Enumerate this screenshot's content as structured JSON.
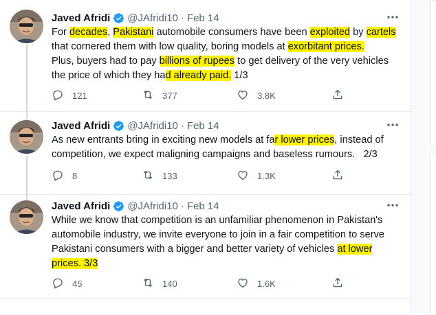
{
  "tweets": [
    {
      "name": "Javed Afridi",
      "handle": "@JAfridi10",
      "separator": "·",
      "date": "Feb 14",
      "body_segments": [
        {
          "text": "For ",
          "hl": false
        },
        {
          "text": "decades",
          "hl": true
        },
        {
          "text": ", ",
          "hl": false
        },
        {
          "text": "Pakistani",
          "hl": true
        },
        {
          "text": " automobile consumers have been ",
          "hl": false
        },
        {
          "text": "exploited",
          "hl": true
        },
        {
          "text": " by ",
          "hl": false
        },
        {
          "text": "cartels",
          "hl": true
        },
        {
          "text": "\nthat cornered them with low quality, boring models at ",
          "hl": false
        },
        {
          "text": "exorbitant prices.",
          "hl": true
        },
        {
          "text": "\nPlus, buyers had to pay ",
          "hl": false
        },
        {
          "text": "billions of rupees",
          "hl": true
        },
        {
          "text": " to get delivery of the very vehicles\nthe price of which they ha",
          "hl": false
        },
        {
          "text": "d already paid.",
          "hl": true
        },
        {
          "text": " 1/3",
          "hl": false
        }
      ],
      "replies": "121",
      "retweets": "377",
      "likes": "3.8K"
    },
    {
      "name": "Javed Afridi",
      "handle": "@JAfridi10",
      "separator": "·",
      "date": "Feb 14",
      "body_segments": [
        {
          "text": "As new entrants bring in exciting new models at fa",
          "hl": false
        },
        {
          "text": "r lower prices",
          "hl": true
        },
        {
          "text": ", instead of\ncompetition, we expect maligning campaigns and baseless rumours.   2/3",
          "hl": false
        }
      ],
      "replies": "8",
      "retweets": "133",
      "likes": "1.3K"
    },
    {
      "name": "Javed Afridi",
      "handle": "@JAfridi10",
      "separator": "·",
      "date": "Feb 14",
      "body_segments": [
        {
          "text": "While we know that competition is an unfamiliar phenomenon in Pakistan's\nautomobile industry, we invite everyone to join in a fair competition to serve\nPakistani consumers with a bigger and better variety of vehicles ",
          "hl": false
        },
        {
          "text": "at lower",
          "hl": true
        },
        {
          "text": "\n",
          "hl": false
        },
        {
          "text": "prices. 3/3",
          "hl": true
        }
      ],
      "replies": "45",
      "retweets": "140",
      "likes": "1.6K"
    }
  ],
  "icons": {
    "verified": "verified-badge-icon",
    "more": "more-options-icon",
    "reply": "reply-icon",
    "retweet": "retweet-icon",
    "like": "like-icon",
    "share": "share-icon"
  },
  "colors": {
    "highlight": "#fff200",
    "verified": "#1d9bf0",
    "secondary_text": "#536471"
  }
}
